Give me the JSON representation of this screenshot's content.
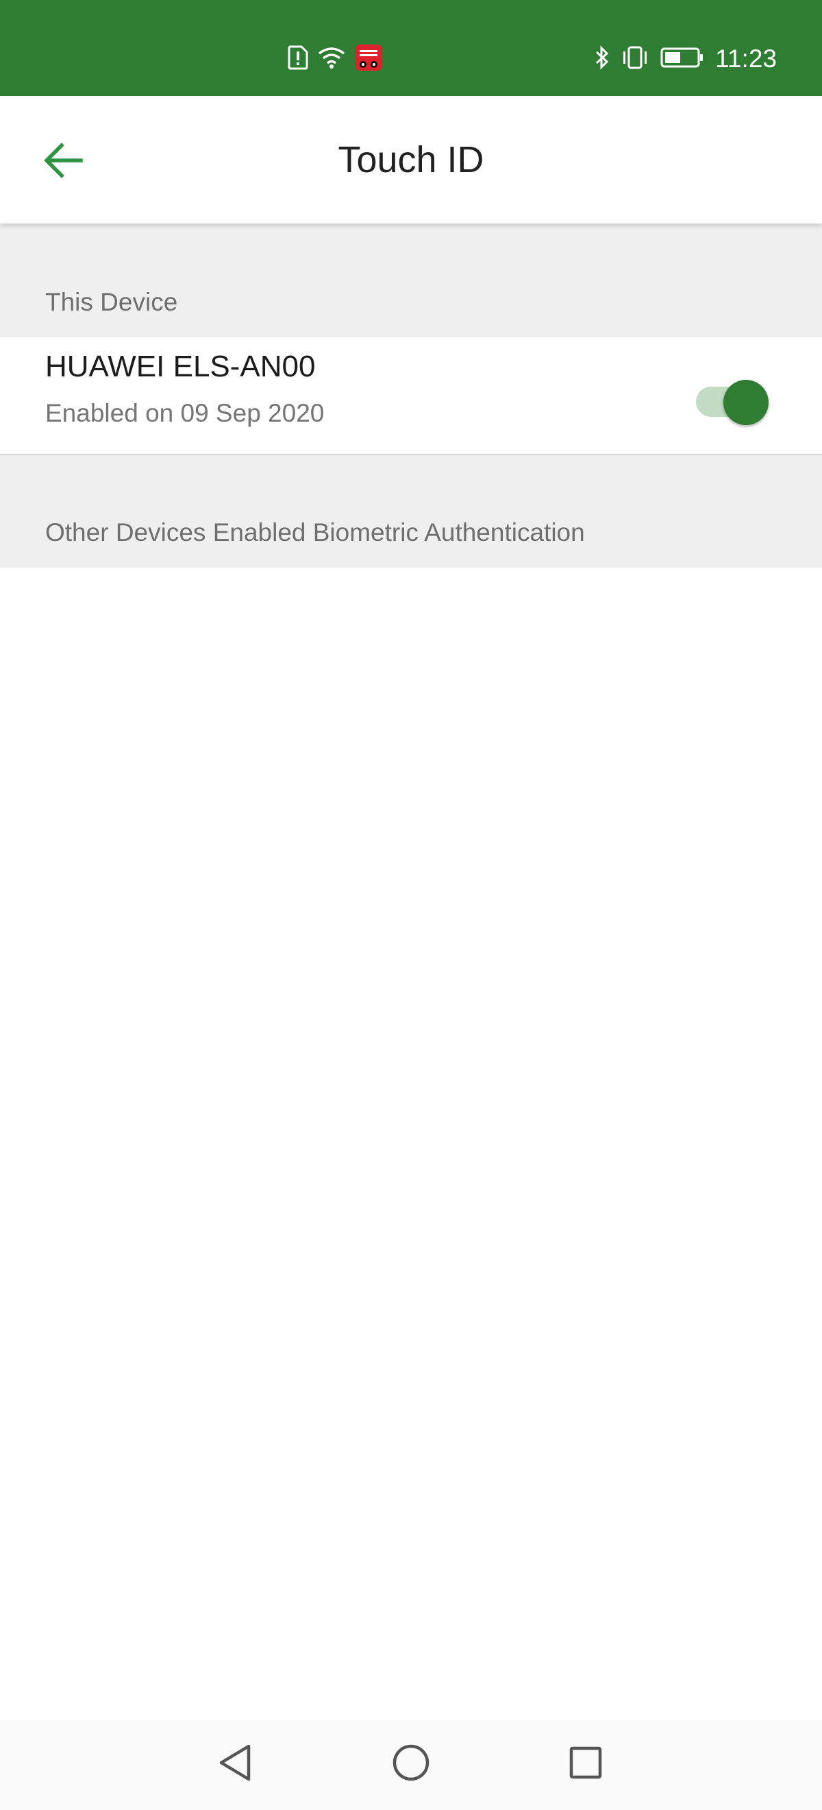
{
  "status_bar": {
    "time": "11:23",
    "icons": [
      "sim-alert-icon",
      "wifi-icon",
      "tmall-app-icon",
      "bluetooth-icon",
      "vibrate-icon",
      "battery-icon"
    ]
  },
  "app_bar": {
    "title": "Touch ID",
    "back_icon": "arrow-left-icon"
  },
  "this_device": {
    "section_title": "This Device",
    "device_name": "HUAWEI ELS-AN00",
    "enabled_text": "Enabled on 09 Sep 2020",
    "toggle_on": true
  },
  "other_devices": {
    "section_title": "Other Devices Enabled Biometric Authentication"
  },
  "nav_bar": {
    "icons": [
      "back-triangle-icon",
      "home-circle-icon",
      "recents-square-icon"
    ]
  },
  "colors": {
    "primary": "#2e7d32",
    "toggle_track": "#c2dcc3",
    "section_bg": "#efefef"
  }
}
